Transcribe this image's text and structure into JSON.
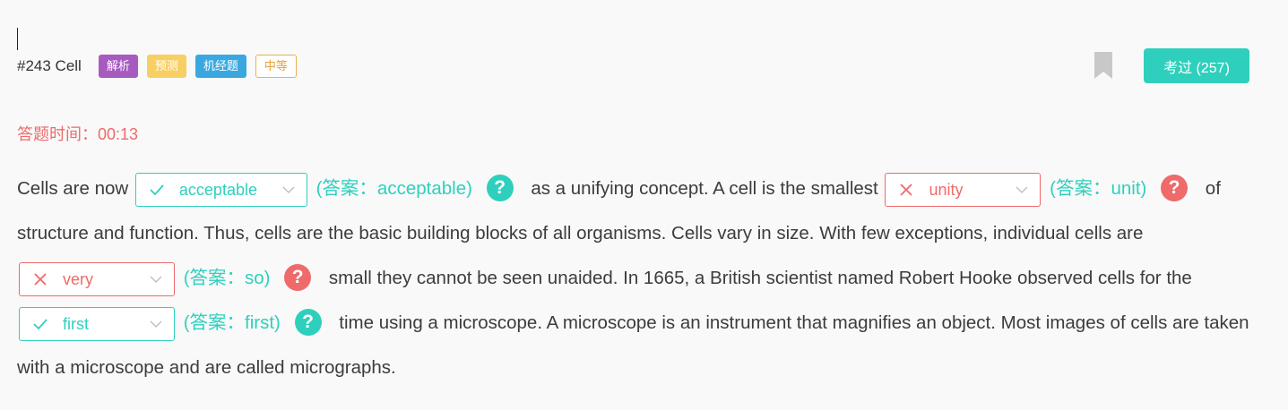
{
  "header": {
    "question_id": "#243 Cell",
    "tags": [
      {
        "label": "解析",
        "color": "#a75bc0"
      },
      {
        "label": "预测",
        "color": "#f8cf62"
      },
      {
        "label": "机经题",
        "color": "#3aa8e0"
      },
      {
        "label": "中等",
        "color": "#e3a23b"
      }
    ],
    "exam_button": "考过 (257)"
  },
  "timer": "答题时间：00:13",
  "passage": {
    "segments": [
      "Cells are now",
      "as a unifying concept. A cell is the smallest",
      "of structure and function. Thus, cells are the basic building blocks of all organisms. Cells vary in size. With few exceptions, individual cells are",
      "small they cannot be seen unaided. In 1665, a British scientist named Robert Hooke observed cells for the",
      "time using a microscope. A microscope is an instrument that magnifies an object. Most images of cells are taken with a microscope and are called micrographs."
    ],
    "blanks": [
      {
        "selected": "acceptable",
        "answer": "(答案：acceptable)",
        "correct": true
      },
      {
        "selected": "unity",
        "answer": "(答案：unit)",
        "correct": false
      },
      {
        "selected": "very",
        "answer": "(答案：so)",
        "correct": false
      },
      {
        "selected": "first",
        "answer": "(答案：first)",
        "correct": true
      }
    ],
    "help_glyph": "?"
  },
  "colors": {
    "correct": "#2ed0bd",
    "wrong": "#ef6a6a",
    "text": "#3c3c3c"
  }
}
